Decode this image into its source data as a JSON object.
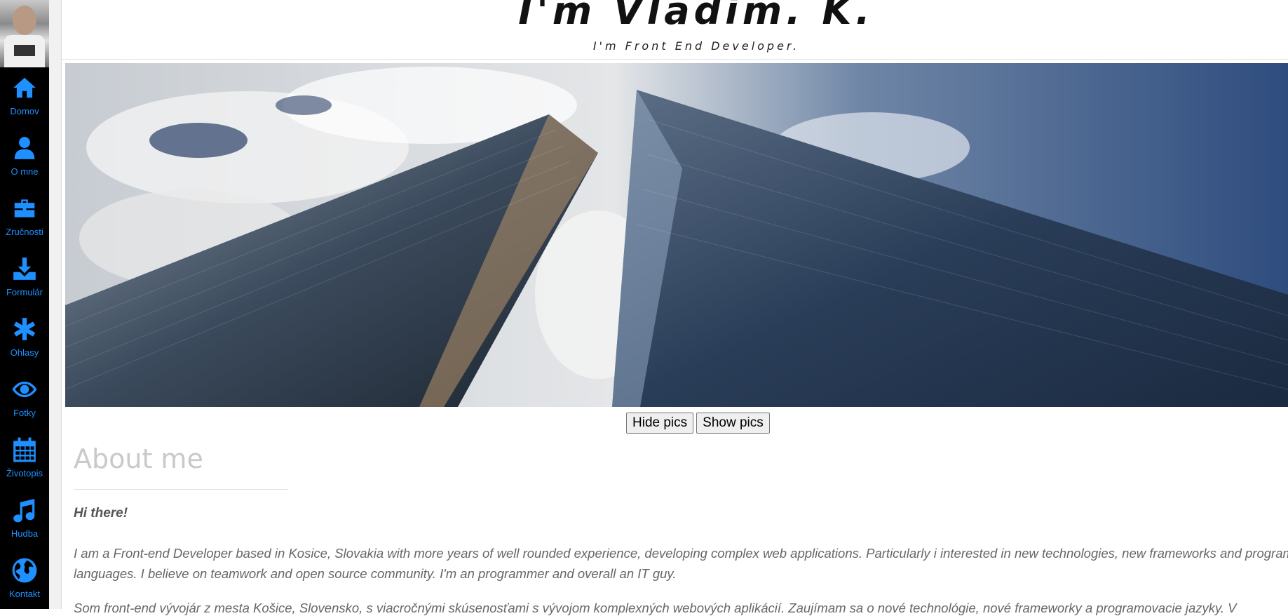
{
  "header": {
    "title": "I'm Vladim. K.",
    "subtitle": "I'm Front End Developer."
  },
  "sidebar": {
    "items": [
      {
        "label": "Domov",
        "icon": "home-icon"
      },
      {
        "label": "O mne",
        "icon": "user-icon"
      },
      {
        "label": "Zručnosti",
        "icon": "briefcase-icon"
      },
      {
        "label": "Formulár",
        "icon": "download-icon"
      },
      {
        "label": "Ohlasy",
        "icon": "asterisk-icon"
      },
      {
        "label": "Fotky",
        "icon": "eye-icon"
      },
      {
        "label": "Životopis",
        "icon": "calendar-icon"
      },
      {
        "label": "Hudba",
        "icon": "music-icon"
      },
      {
        "label": "Kontakt",
        "icon": "globe-icon"
      }
    ],
    "accent_color": "#1e90ff"
  },
  "buttons": {
    "hide": "Hide pics",
    "show": "Show pics"
  },
  "about": {
    "title": "About me",
    "greeting": "Hi there!",
    "paragraph_line1": "I am a Front-end Developer based in Kosice, Slovakia with more years of well rounded experience, developing complex web applications. Particularly i interested in new technologies, new frameworks and program",
    "paragraph_line2": "languages. I believe on teamwork and open source community. I'm an programmer and overall an IT guy.",
    "paragraph2_partial": "Som front-end vývojár z mesta Košice, Slovensko, s viacročnými skúsenosťami s vývojom komplexných webových aplikácií. Zaujímam sa o nové technológie, nové frameworky a programovacie jazyky. V"
  }
}
